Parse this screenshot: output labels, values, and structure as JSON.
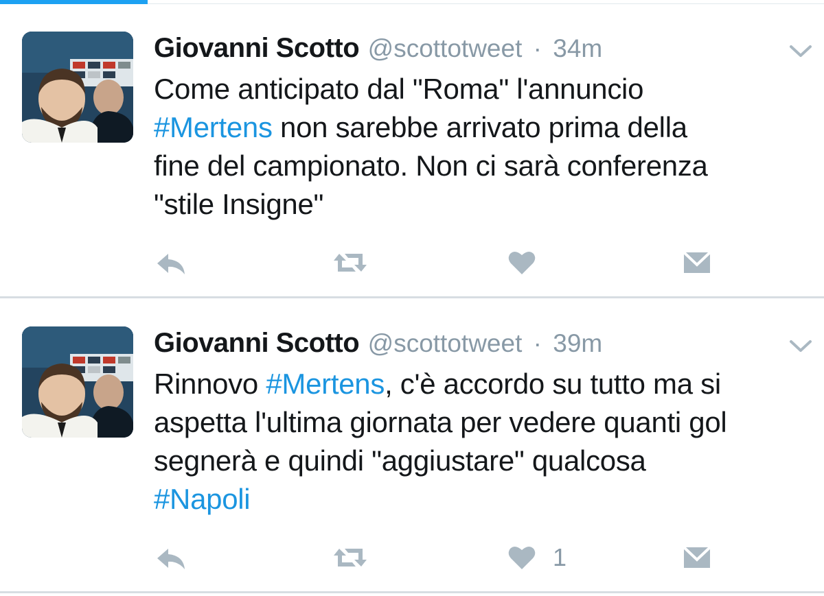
{
  "tweets": [
    {
      "name": "Giovanni Scotto",
      "handle": "@scottotweet",
      "separator": "·",
      "time": "34m",
      "lines": [
        [
          {
            "text": "Come anticipato dal \"Roma\" l'annuncio"
          }
        ],
        [
          {
            "text": "#Mertens",
            "hashtag": true
          },
          {
            "text": " non sarebbe arrivato prima della"
          }
        ],
        [
          {
            "text": "fine del campionato. Non ci sarà conferenza"
          }
        ],
        [
          {
            "text": "\"stile Insigne\""
          }
        ]
      ],
      "like_count": ""
    },
    {
      "name": "Giovanni Scotto",
      "handle": "@scottotweet",
      "separator": "·",
      "time": "39m",
      "lines": [
        [
          {
            "text": "Rinnovo "
          },
          {
            "text": "#Mertens",
            "hashtag": true
          },
          {
            "text": ", c'è accordo su tutto ma si"
          }
        ],
        [
          {
            "text": "aspetta l'ultima giornata per vedere quanti gol"
          }
        ],
        [
          {
            "text": "segnerà e quindi \"aggiustare\" qualcosa"
          }
        ],
        [
          {
            "text": "#Napoli",
            "hashtag": true
          }
        ]
      ],
      "like_count": "1"
    }
  ],
  "icons": {
    "reply": "reply-icon",
    "retweet": "retweet-icon",
    "like": "heart-icon",
    "dm": "direct-message-icon",
    "caret": "chevron-down-icon"
  },
  "colors": {
    "accent": "#1da1f2",
    "hashtag": "#1b95e0",
    "text": "#14171a",
    "muted": "#8899a6",
    "icon": "#aab8c2",
    "divider": "#d7dde2"
  }
}
